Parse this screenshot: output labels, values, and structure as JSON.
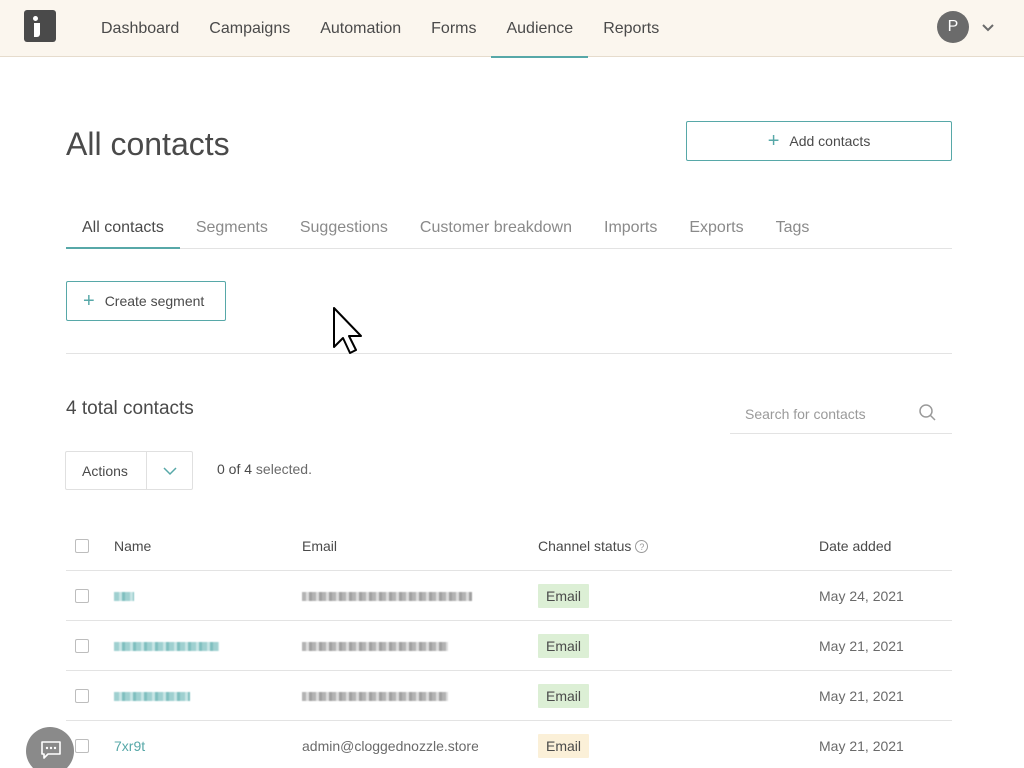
{
  "nav": {
    "items": [
      {
        "label": "Dashboard"
      },
      {
        "label": "Campaigns"
      },
      {
        "label": "Automation"
      },
      {
        "label": "Forms"
      },
      {
        "label": "Audience",
        "active": true
      },
      {
        "label": "Reports"
      }
    ],
    "avatar_initial": "P"
  },
  "page": {
    "title": "All contacts",
    "add_contacts_label": "Add contacts"
  },
  "tabs": [
    {
      "label": "All contacts",
      "active": true
    },
    {
      "label": "Segments"
    },
    {
      "label": "Suggestions"
    },
    {
      "label": "Customer breakdown"
    },
    {
      "label": "Imports"
    },
    {
      "label": "Exports"
    },
    {
      "label": "Tags"
    }
  ],
  "segment": {
    "create_label": "Create segment"
  },
  "list": {
    "total_label": "4 total contacts",
    "search_placeholder": "Search for contacts",
    "actions_label": "Actions",
    "selected_count": "0 of 4",
    "selected_suffix": " selected."
  },
  "table": {
    "headers": {
      "name": "Name",
      "email": "Email",
      "channel_status": "Channel status",
      "date_added": "Date added"
    },
    "rows": [
      {
        "name": "",
        "email": "",
        "status": "Email",
        "date": "May 24, 2021"
      },
      {
        "name": "",
        "email": "",
        "status": "Email",
        "date": "May 21, 2021"
      },
      {
        "name": "",
        "email": "",
        "status": "Email",
        "date": "May 21, 2021"
      },
      {
        "name": "7xr9t",
        "email": "admin@cloggednozzle.store",
        "status": "Email",
        "date": "May 21, 2021"
      }
    ]
  },
  "colors": {
    "accent": "#57a8a8",
    "topbar": "#fbf6ee",
    "badge_green": "#dcefd5",
    "badge_amber": "#fbf0d8"
  }
}
